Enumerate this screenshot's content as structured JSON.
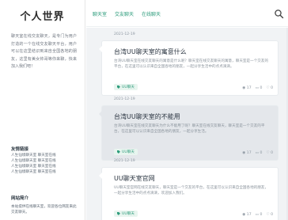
{
  "sidebar": {
    "brand": "个人世界",
    "about": "聊天室在线交友聊天，是专门为用户打造的一个在线交友聊天平台，用户可以在这里结识到来自全国各地的朋友，这里有美女帅哥等你来聊，快来加入我们吧！",
    "links_title": "友情链接",
    "links": [
      "人生仙境聊天室 聊天室在线",
      "人生仙境聊天室 聊天室在线",
      "人生仙境聊天室 聊天室在线",
      "人生仙境聊天室 聊天室在线"
    ],
    "desc_title": "网站简介",
    "desc": "本站提供在线聊天室，欢迎各位网友来此交友聊天。"
  },
  "nav": {
    "items": [
      "聊天室",
      "交友聊天",
      "在线聊天"
    ],
    "search_icon": "search-icon"
  },
  "posts": [
    {
      "date": "2021-12-19",
      "title": "台湾UU聊天室的寓意什么",
      "excerpt": "台湾UU聊天室在线交友聊天的寓意是什么呢？聊天室在线交友聊天的寓意，聊天室是一个交友的平台，在这里可以认识来自全国各地的朋友，一起分享生活中的点点滴滴。",
      "tag": "UU聊天",
      "views": "17",
      "comments": "0",
      "likes": "0",
      "style": "white"
    },
    {
      "date": "2021-12-19",
      "title": "台湾UU聊天室的不能用",
      "excerpt": "台湾UU聊天室在线交友聊天为什么不能用了呢？聊天室在线交友聊天，聊天室是一个交友的平台，在这里可以认识来自全国各地的朋友，一起分享生活。",
      "tag": "UU聊天",
      "views": "17",
      "comments": "0",
      "likes": "0",
      "style": "gray"
    },
    {
      "date": "2021-12-19",
      "title": "UU聊天室官网",
      "excerpt": "UU聊天室官网在线交友聊天，聊天室是一个交友的平台，在这里可以认识来自全国各地的朋友，一起分享生活中的点点滴滴，欢迎加入我们。",
      "tag": "UU聊天",
      "views": "17",
      "comments": "0",
      "likes": "0",
      "style": "white"
    }
  ],
  "colors": {
    "accent": "#2e9c7c",
    "background": "#f1f3f5"
  }
}
